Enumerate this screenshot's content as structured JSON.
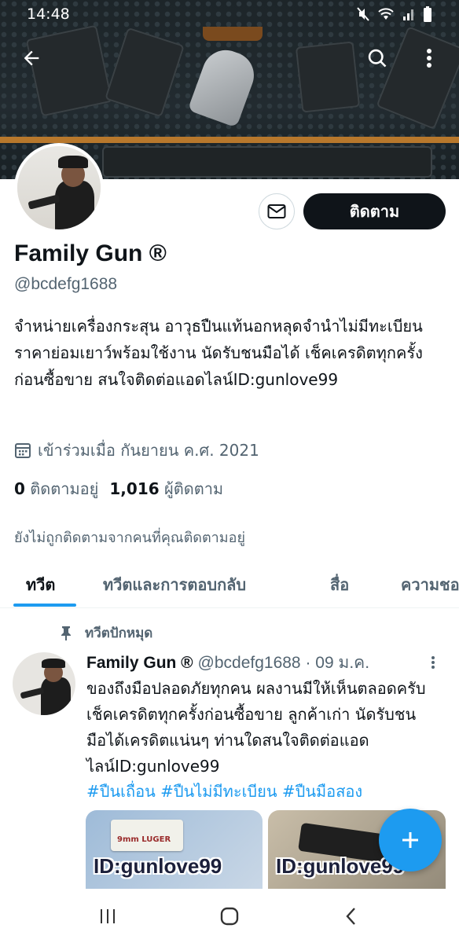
{
  "status_bar": {
    "time": "14:48"
  },
  "profile": {
    "name": "Family Gun ®",
    "handle": "@bcdefg1688",
    "follow_label": "ติดตาม",
    "bio": "จำหน่ายเครื่องกระสุน อาวุธปืนแท้นอกหลุดจำนำไม่มีทะเบียน ราคาย่อมเยาว์พร้อมใช้งาน นัดรับชนมือได้ เช็คเครดิตทุกครั้งก่อนซื้อขาย สนใจติดต่อแอดไลน์ID:gunlove99",
    "joined": "เข้าร่วมเมื่อ กันยายน ค.ศ. 2021",
    "following_count": "0",
    "following_label": "ติดตามอยู่",
    "followers_count": "1,016",
    "followers_label": "ผู้ติดตาม",
    "not_followed_note": "ยังไม่ถูกติดตามจากคนที่คุณติดตามอยู่"
  },
  "tabs": [
    {
      "label": "ทวีต",
      "active": true
    },
    {
      "label": "ทวีตและการตอบกลับ",
      "active": false
    },
    {
      "label": "สื่อ",
      "active": false
    },
    {
      "label": "ความชอบ",
      "active": false
    }
  ],
  "tweet": {
    "pinned_label": "ทวีตปักหมุด",
    "name": "Family Gun ®",
    "handle": "@bcdefg1688",
    "date": "· 09 ม.ค.",
    "text": "ของถึงมือปลอดภัยทุกคน ผลงานมีให้เห็นตลอดครับ เช็คเครดิตทุกครั้งก่อนซื้อขาย ลูกค้าเก่า นัดรับชนมือได้เครดิตแน่นๆ ท่านใดสนใจติดต่อแอดไลน์ID:gunlove99",
    "hashtags": "#ปืนเถื่อน #ปืนไม่มีทะเบียน #ปืนมือสอง",
    "media": [
      {
        "watermark": "ID:gunlove99",
        "box_text": "9mm LUGER"
      },
      {
        "watermark": "ID:gunlove99"
      }
    ]
  },
  "colors": {
    "accent": "#1d9bf0",
    "primary_text": "#0f1419",
    "secondary_text": "#536471"
  },
  "icons": {
    "back": "arrow-left-icon",
    "search": "search-icon",
    "more": "more-vertical-icon",
    "message": "envelope-icon",
    "calendar": "calendar-icon",
    "pin": "pin-icon",
    "compose": "plus-icon",
    "nav_recent": "recent-apps-icon",
    "nav_home": "home-icon",
    "nav_back": "chevron-left-icon"
  }
}
